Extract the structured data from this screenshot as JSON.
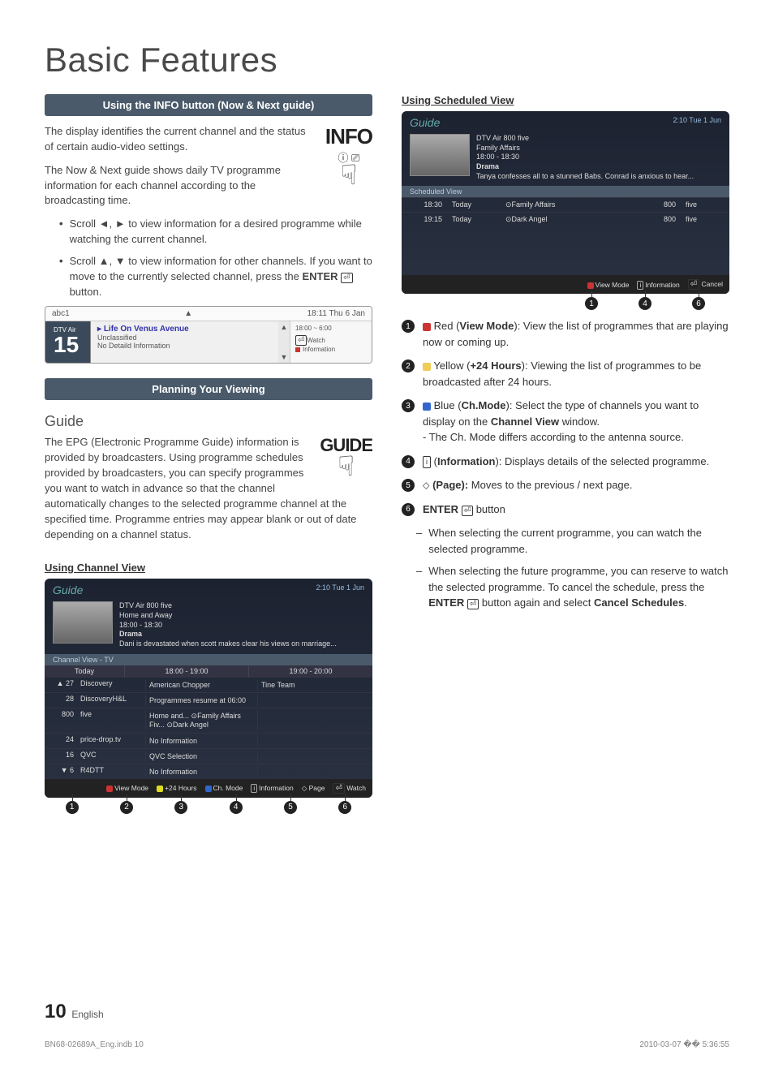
{
  "title": "Basic Features",
  "left": {
    "sec1_title": "Using the INFO button (Now & Next guide)",
    "p1": "The display identifies the current channel and the status of certain audio-video settings.",
    "p2": "The Now & Next guide shows daily TV programme information for each channel according to the broadcasting time.",
    "b1": "Scroll ◄, ► to view information for a desired programme while watching the current channel.",
    "b2_a": "Scroll ▲, ▼ to view information for other channels. If you want to move to the currently selected channel, press the ",
    "b2_enter": "ENTER",
    "b2_b": " button.",
    "info_word": "INFO",
    "info_sub": "ⓘ ⎚",
    "info_strip": {
      "ch_label": "abc1",
      "time": "18:11 Thu 6 Jan",
      "air": "DTV Air",
      "num": "15",
      "prog": "Life On Venus Avenue",
      "class": "Unclassified",
      "detail": "No Detaild Information",
      "range": "18:00 ~ 6:00",
      "watch": "Watch",
      "info": "Information"
    },
    "sec2_title": "Planning Your Viewing",
    "guide_head": "Guide",
    "guide_p": "The EPG (Electronic Programme Guide) information is provided by broadcasters. Using programme schedules provided by broadcasters, you can specify programmes you want to watch in advance so that the channel automatically changes to the selected programme channel at the specified time. Programme entries may appear blank or out of date depending on a channel status.",
    "guide_word": "GUIDE",
    "using_cv": "Using  Channel View",
    "cv_guide_title": "Guide",
    "cv_guide_time": "2:10 Tue 1 Jun",
    "cv_meta": {
      "src": "DTV Air 800 five",
      "prog": "Home and Away",
      "time": "18:00 - 18:30",
      "genre": "Drama",
      "desc": "Dani is devastated when scott makes clear his views on marriage..."
    },
    "cv_tab": "Channel View - TV",
    "cv_head": {
      "today": "Today",
      "s1": "18:00 - 19:00",
      "s2": "19:00 - 20:00"
    },
    "cv_rows": [
      {
        "n": "27",
        "name": "Discovery",
        "c": [
          "American Chopper",
          "Tine Team"
        ]
      },
      {
        "n": "28",
        "name": "DiscoveryH&L",
        "c": [
          "Programmes resume at 06:00",
          ""
        ]
      },
      {
        "n": "800",
        "name": "five",
        "c": [
          "Home and...   ⊙Family Affairs   Fiv...   ⊙Dark Angel",
          ""
        ]
      },
      {
        "n": "24",
        "name": "price-drop.tv",
        "c": [
          "No Information",
          ""
        ]
      },
      {
        "n": "16",
        "name": "QVC",
        "c": [
          "QVC Selection",
          ""
        ]
      },
      {
        "n": "6",
        "name": "R4DTT",
        "c": [
          "No Information",
          ""
        ]
      }
    ],
    "cv_footer": {
      "vm": "View Mode",
      "h24": "+24 Hours",
      "chm": "Ch. Mode",
      "info": "Information",
      "page": "Page",
      "watch": "Watch"
    }
  },
  "right": {
    "sched_head": "Using Scheduled View",
    "sv_guide_title": "Guide",
    "sv_guide_time": "2:10 Tue 1 Jun",
    "sv_meta": {
      "src": "DTV Air 800 five",
      "prog": "Family Affairs",
      "time": "18:00 - 18:30",
      "genre": "Drama",
      "desc": "Tanya confesses all to a stunned Babs. Conrad is anxious to hear..."
    },
    "sv_tab": "Scheduled View",
    "sv_rows": [
      {
        "t": "18:30",
        "d": "Today",
        "p": "⊙Family Affairs",
        "n": "800",
        "c": "five"
      },
      {
        "t": "19:15",
        "d": "Today",
        "p": "⊙Dark Angel",
        "n": "800",
        "c": "five"
      }
    ],
    "sv_footer": {
      "vm": "View Mode",
      "info": "Information",
      "cancel": "Cancel"
    },
    "items": {
      "i1_b": "Red (",
      "i1_bold": "View Mode",
      "i1_a": "): View the list of programmes that are playing now or coming up.",
      "i2_b": "Yellow (",
      "i2_bold": "+24 Hours",
      "i2_a": "): Viewing the list of programmes to be broadcasted after 24 hours.",
      "i3_b": "Blue (",
      "i3_bold": "Ch.Mode",
      "i3_a": "): Select the type of channels you want to display on the ",
      "i3_bold2": "Channel View",
      "i3_a2": " window.",
      "i3_note": "- The Ch. Mode differs according to the antenna source.",
      "i4_b": "(",
      "i4_bold": "Information",
      "i4_a": "): Displays details of the selected programme.",
      "i5_bold": "(Page):",
      "i5_a": " Moves to the previous / next page.",
      "i6_bold": "ENTER",
      "i6_a": " button",
      "d1": "When selecting the current programme, you can watch the selected programme.",
      "d2_a": "When selecting the future programme, you can reserve to watch the selected programme. To cancel the schedule, press the ",
      "d2_b": " button again and select ",
      "d2_bold": "Cancel Schedules",
      "d2_c": "."
    }
  },
  "page_num": "10",
  "page_lang": "English",
  "foot_left": "BN68-02689A_Eng.indb   10",
  "foot_right": "2010-03-07   �� 5:36:55"
}
